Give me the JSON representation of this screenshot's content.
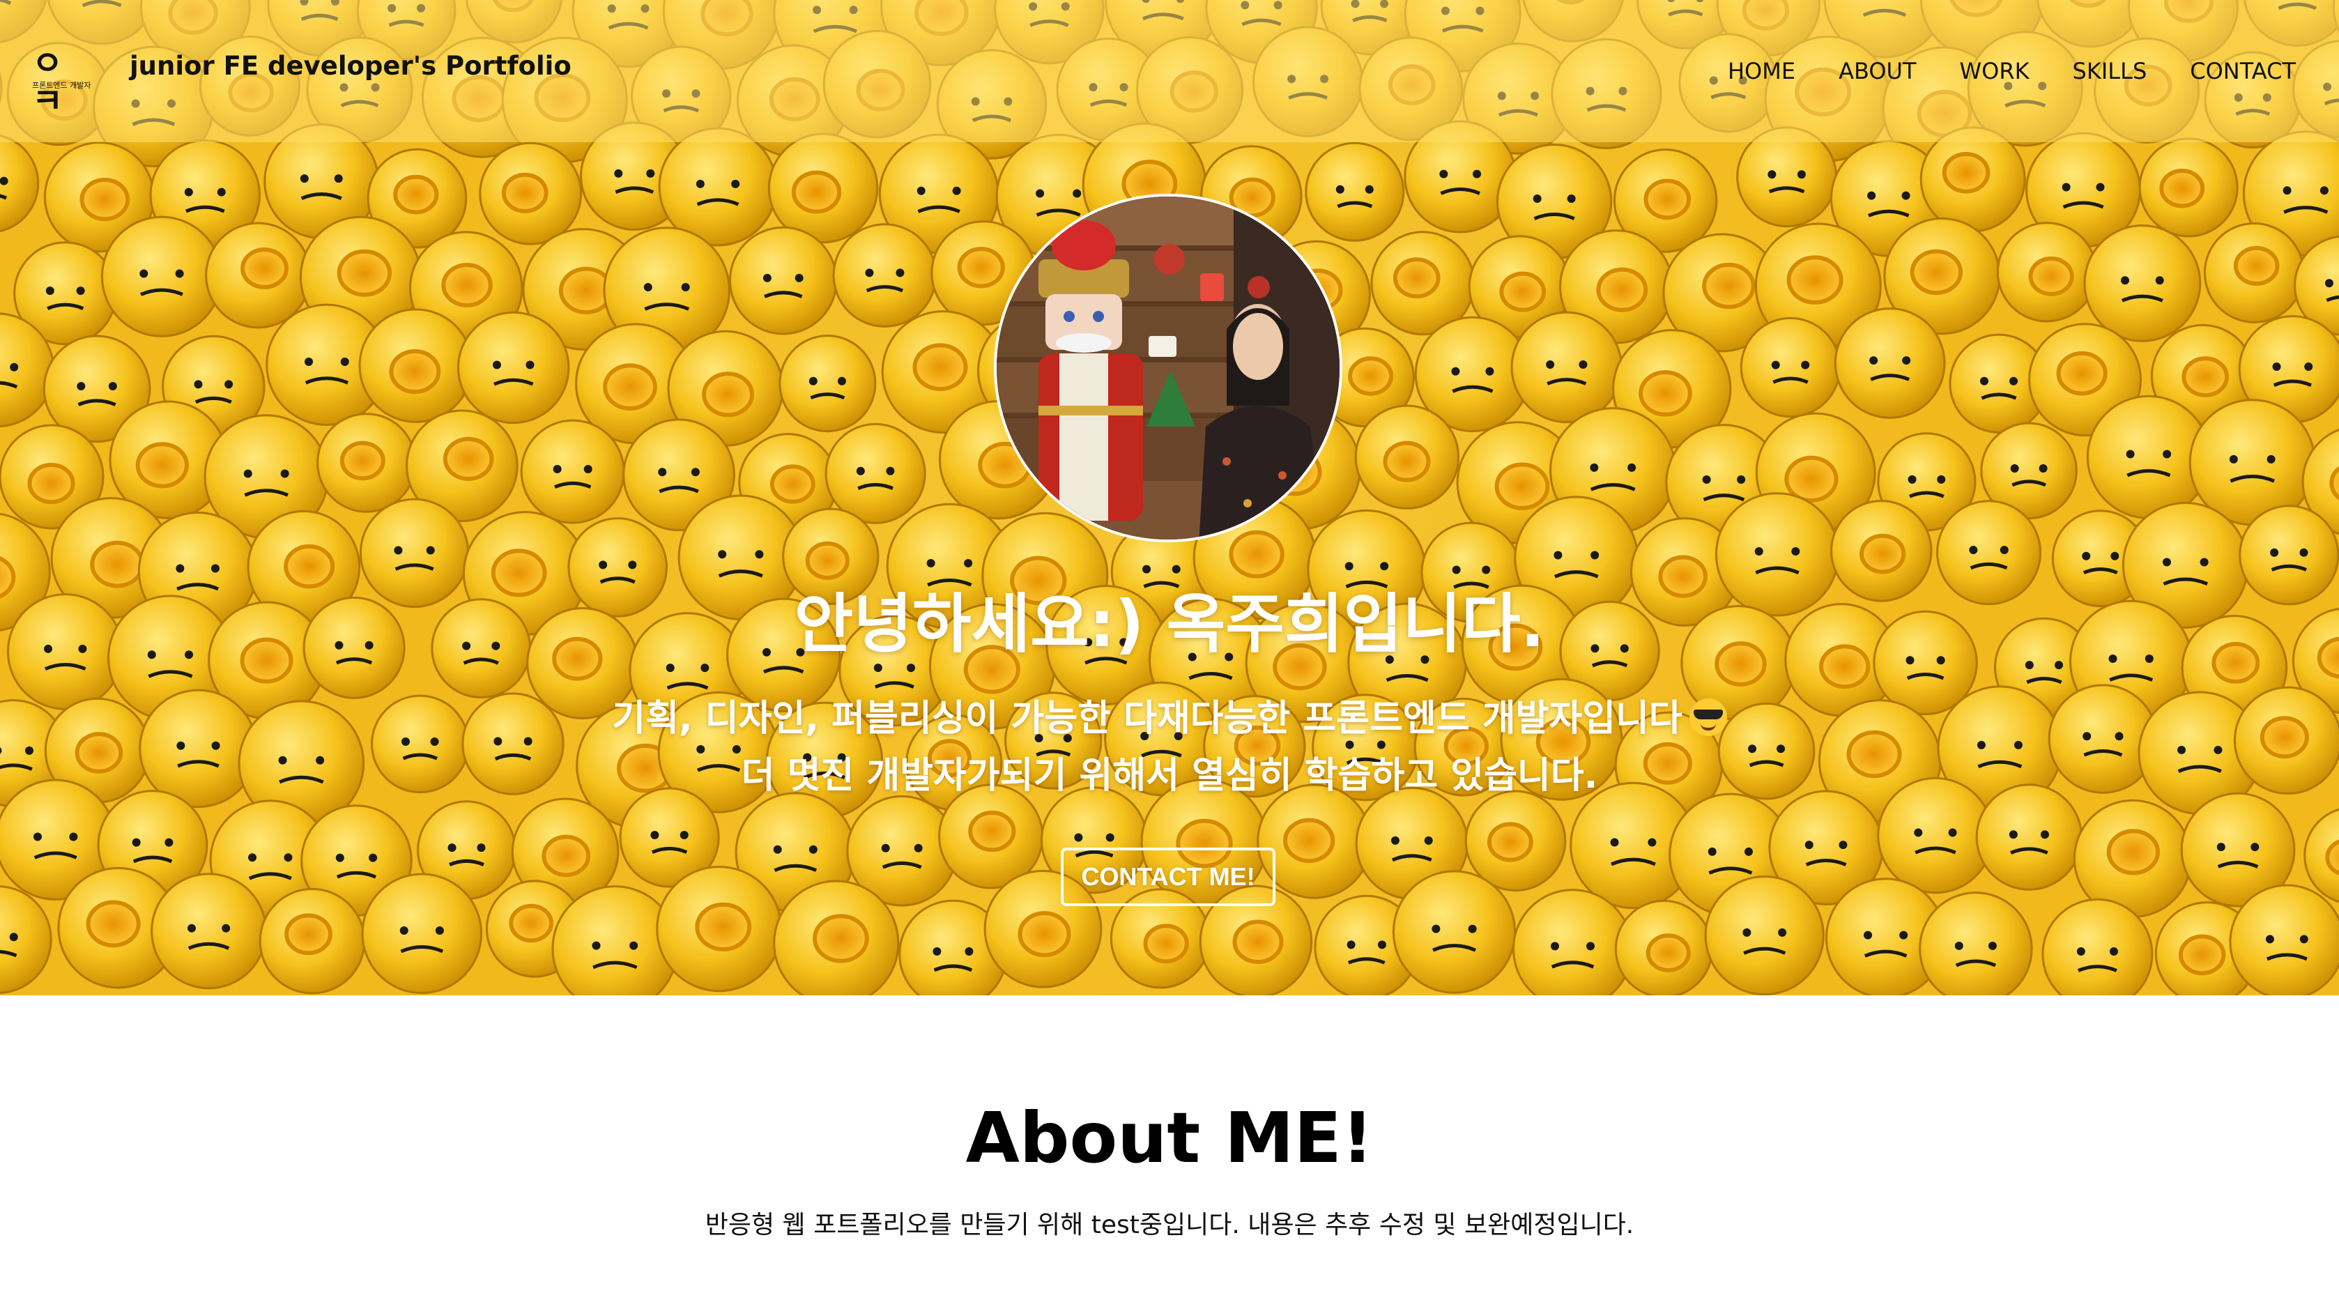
{
  "colors": {
    "hero_background": "#f2b91c",
    "navbar_overlay": "#ffe06e",
    "hero_text": "#ffffff",
    "about_background": "#ffffff"
  },
  "navbar": {
    "logo_glyph": "ㅇㅋ",
    "logo_subtext": "프론트엔드 개발자",
    "brand_title": "junior FE developer's Portfolio",
    "menu": [
      {
        "label": "HOME"
      },
      {
        "label": "ABOUT"
      },
      {
        "label": "WORK"
      },
      {
        "label": "SKILLS"
      },
      {
        "label": "CONTACT"
      }
    ]
  },
  "hero": {
    "background_icon": "lego-minifigure-heads-pattern",
    "avatar_icon": "profile-photo",
    "heading": "안녕하세요:) 옥주희입니다.",
    "description_line1": "기획, 디자인, 퍼블리싱이 가능한 다재다능한 프론트엔드 개발자입니다",
    "description_emoji": "sunglasses-emoji",
    "description_line2": "더 멋진 개발자가되기 위해서 열심히 학습하고 있습니다.",
    "contact_button": "CONTACT ME!"
  },
  "about": {
    "title": "About ME!",
    "text": "반응형 웹 포트폴리오를 만들기 위해 test중입니다. 내용은 추후 수정 및 보완예정입니다."
  }
}
